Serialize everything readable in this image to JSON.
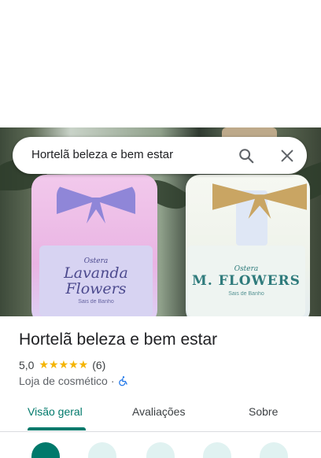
{
  "search": {
    "query": "Hortelã beleza e bem estar"
  },
  "hero": {
    "jar_left": {
      "brand": "Ostera",
      "product_line1": "Lavanda",
      "product_line2": "Flowers",
      "subtitle": "Sais de Banho"
    },
    "jar_right": {
      "brand": "Ostera",
      "product": "M. FLOWERS",
      "subtitle": "Sais de Banho"
    }
  },
  "place": {
    "name": "Hortelã beleza e bem estar",
    "rating": "5,0",
    "stars": "★★★★★",
    "review_count": "(6)",
    "category": "Loja de cosmético",
    "separator": "·"
  },
  "tabs": [
    {
      "label": "Visão geral",
      "active": true
    },
    {
      "label": "Avaliações",
      "active": false
    },
    {
      "label": "Sobre",
      "active": false
    }
  ],
  "colors": {
    "accent": "#00796b",
    "star": "#f4b400",
    "accessibility": "#1a73e8"
  },
  "icons": {
    "search": "search-icon",
    "close": "close-icon",
    "accessibility": "wheelchair-icon"
  }
}
